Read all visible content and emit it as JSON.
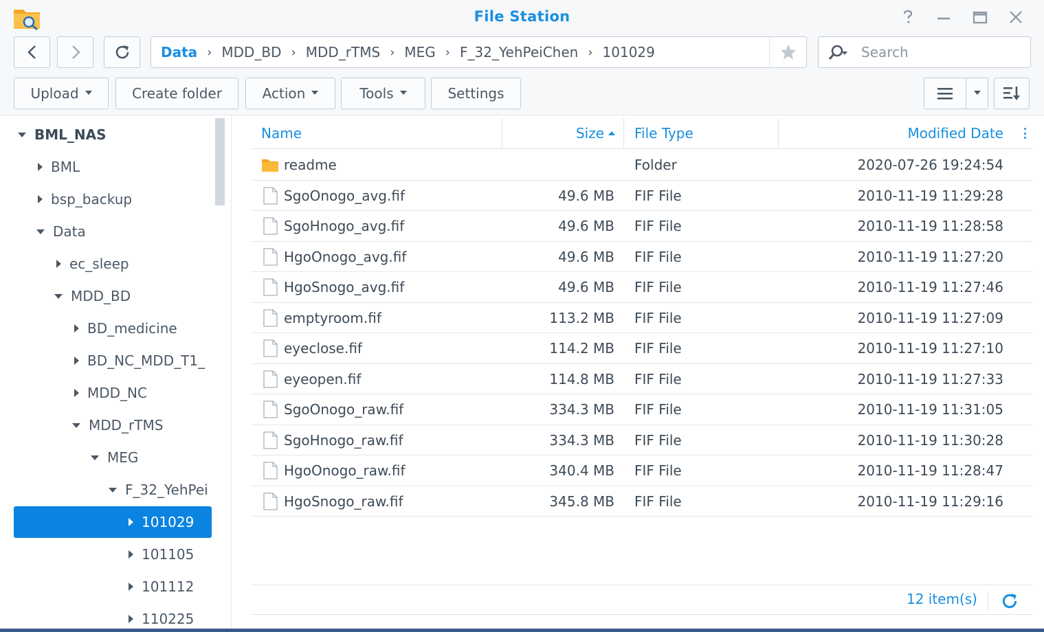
{
  "window": {
    "title": "File Station",
    "help_icon": "help-icon",
    "minimize_icon": "minimize-icon",
    "maximize_icon": "maximize-icon",
    "close_icon": "close-icon"
  },
  "navigation": {
    "back_icon": "chevron-left-icon",
    "forward_icon": "chevron-right-icon",
    "refresh_icon": "refresh-icon"
  },
  "path": {
    "segments": [
      "Data",
      "MDD_BD",
      "MDD_rTMS",
      "MEG",
      "F_32_YehPeiChen",
      "101029"
    ],
    "separator": "›",
    "favorite_icon": "star-icon"
  },
  "search": {
    "placeholder": "Search",
    "icon": "search-icon"
  },
  "toolbar": {
    "upload": "Upload",
    "create_folder": "Create folder",
    "action": "Action",
    "tools": "Tools",
    "settings": "Settings",
    "list_view_icon": "list-view-icon",
    "sort_icon": "sort-icon"
  },
  "tree": {
    "items": [
      {
        "label": "BML_NAS",
        "state": "expanded",
        "level": 0,
        "selected": false
      },
      {
        "label": "BML",
        "state": "collapsed",
        "level": 1,
        "selected": false
      },
      {
        "label": "bsp_backup",
        "state": "collapsed",
        "level": 1,
        "selected": false
      },
      {
        "label": "Data",
        "state": "expanded",
        "level": 1,
        "selected": false
      },
      {
        "label": "ec_sleep",
        "state": "collapsed",
        "level": 2,
        "selected": false
      },
      {
        "label": "MDD_BD",
        "state": "expanded",
        "level": 2,
        "selected": false
      },
      {
        "label": "BD_medicine",
        "state": "collapsed",
        "level": 3,
        "selected": false
      },
      {
        "label": "BD_NC_MDD_T1_",
        "state": "collapsed",
        "level": 3,
        "selected": false
      },
      {
        "label": "MDD_NC",
        "state": "collapsed",
        "level": 3,
        "selected": false
      },
      {
        "label": "MDD_rTMS",
        "state": "expanded",
        "level": 3,
        "selected": false
      },
      {
        "label": "MEG",
        "state": "expanded",
        "level": 4,
        "selected": false
      },
      {
        "label": "F_32_YehPei",
        "state": "expanded",
        "level": 5,
        "selected": false
      },
      {
        "label": "101029",
        "state": "collapsed",
        "level": 6,
        "selected": true
      },
      {
        "label": "101105",
        "state": "collapsed",
        "level": 6,
        "selected": false
      },
      {
        "label": "101112",
        "state": "collapsed",
        "level": 6,
        "selected": false
      },
      {
        "label": "110225",
        "state": "collapsed",
        "level": 6,
        "selected": false
      }
    ]
  },
  "table": {
    "columns": {
      "name": "Name",
      "size": "Size",
      "type": "File Type",
      "modified": "Modified Date"
    },
    "rows": [
      {
        "name": "readme",
        "size": "",
        "type": "Folder",
        "modified": "2020-07-26 19:24:54",
        "icon": "folder-icon"
      },
      {
        "name": "SgoOnogo_avg.fif",
        "size": "49.6 MB",
        "type": "FIF File",
        "modified": "2010-11-19 11:29:28",
        "icon": "file-icon"
      },
      {
        "name": "SgoHnogo_avg.fif",
        "size": "49.6 MB",
        "type": "FIF File",
        "modified": "2010-11-19 11:28:58",
        "icon": "file-icon"
      },
      {
        "name": "HgoOnogo_avg.fif",
        "size": "49.6 MB",
        "type": "FIF File",
        "modified": "2010-11-19 11:27:20",
        "icon": "file-icon"
      },
      {
        "name": "HgoSnogo_avg.fif",
        "size": "49.6 MB",
        "type": "FIF File",
        "modified": "2010-11-19 11:27:46",
        "icon": "file-icon"
      },
      {
        "name": "emptyroom.fif",
        "size": "113.2 MB",
        "type": "FIF File",
        "modified": "2010-11-19 11:27:09",
        "icon": "file-icon"
      },
      {
        "name": "eyeclose.fif",
        "size": "114.2 MB",
        "type": "FIF File",
        "modified": "2010-11-19 11:27:10",
        "icon": "file-icon"
      },
      {
        "name": "eyeopen.fif",
        "size": "114.8 MB",
        "type": "FIF File",
        "modified": "2010-11-19 11:27:33",
        "icon": "file-icon"
      },
      {
        "name": "SgoOnogo_raw.fif",
        "size": "334.3 MB",
        "type": "FIF File",
        "modified": "2010-11-19 11:31:05",
        "icon": "file-icon"
      },
      {
        "name": "SgoHnogo_raw.fif",
        "size": "334.3 MB",
        "type": "FIF File",
        "modified": "2010-11-19 11:30:28",
        "icon": "file-icon"
      },
      {
        "name": "HgoOnogo_raw.fif",
        "size": "340.4 MB",
        "type": "FIF File",
        "modified": "2010-11-19 11:28:47",
        "icon": "file-icon"
      },
      {
        "name": "HgoSnogo_raw.fif",
        "size": "345.8 MB",
        "type": "FIF File",
        "modified": "2010-11-19 11:29:16",
        "icon": "file-icon"
      }
    ]
  },
  "footer": {
    "item_count": "12 item(s)",
    "refresh_icon": "refresh-icon"
  },
  "colors": {
    "accent": "#1a8fe0",
    "selected_bg": "#0a84e0",
    "folder": "#f5a623"
  }
}
